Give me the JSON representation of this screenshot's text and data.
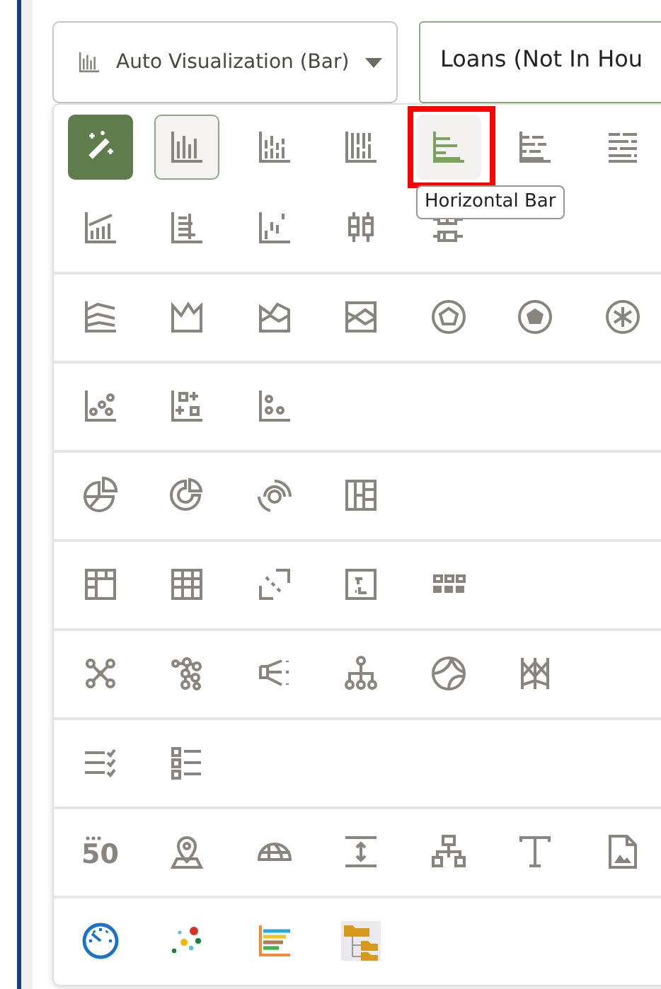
{
  "visualization_dropdown": {
    "label": "Auto Visualization (Bar)"
  },
  "data_field": {
    "value": "Loans (Not In Hou"
  },
  "groups": [
    {
      "items": [
        {
          "kind": "auto",
          "selected": false,
          "hovered": false
        },
        {
          "kind": "bar",
          "selected": true,
          "hovered": false
        },
        {
          "kind": "stacked-bar",
          "selected": false,
          "hovered": false
        },
        {
          "kind": "stacked-bar-full",
          "selected": false,
          "hovered": false
        },
        {
          "kind": "horizontal-bar",
          "selected": false,
          "hovered": true,
          "tooltip": "Horizontal Bar"
        },
        {
          "kind": "horizontal-stacked",
          "selected": false,
          "hovered": false
        },
        {
          "kind": "horizontal-stacked-full",
          "selected": false,
          "hovered": false
        },
        {
          "kind": "combo",
          "selected": false,
          "hovered": false
        },
        {
          "kind": "horizontal-combo",
          "selected": false,
          "hovered": false
        },
        {
          "kind": "waterfall",
          "selected": false,
          "hovered": false
        },
        {
          "kind": "boxplot",
          "selected": false,
          "hovered": false
        },
        {
          "kind": "horizontal-boxplot",
          "selected": false,
          "hovered": false
        }
      ]
    },
    {
      "items": [
        {
          "kind": "line",
          "selected": false,
          "hovered": false
        },
        {
          "kind": "area",
          "selected": false,
          "hovered": false
        },
        {
          "kind": "stacked-area",
          "selected": false,
          "hovered": false
        },
        {
          "kind": "area-full",
          "selected": false,
          "hovered": false
        },
        {
          "kind": "radar-line",
          "selected": false,
          "hovered": false
        },
        {
          "kind": "radar-filled",
          "selected": false,
          "hovered": false
        },
        {
          "kind": "radar-bar",
          "selected": false,
          "hovered": false
        }
      ]
    },
    {
      "items": [
        {
          "kind": "scatter",
          "selected": false,
          "hovered": false
        },
        {
          "kind": "scatter-symbols",
          "selected": false,
          "hovered": false
        },
        {
          "kind": "dot-plot",
          "selected": false,
          "hovered": false
        }
      ]
    },
    {
      "items": [
        {
          "kind": "pie",
          "selected": false,
          "hovered": false
        },
        {
          "kind": "donut",
          "selected": false,
          "hovered": false
        },
        {
          "kind": "sunburst",
          "selected": false,
          "hovered": false
        },
        {
          "kind": "treemap",
          "selected": false,
          "hovered": false
        }
      ]
    },
    {
      "items": [
        {
          "kind": "pivot",
          "selected": false,
          "hovered": false
        },
        {
          "kind": "table",
          "selected": false,
          "hovered": false
        },
        {
          "kind": "matrix",
          "selected": false,
          "hovered": false
        },
        {
          "kind": "heatmap",
          "selected": false,
          "hovered": false
        },
        {
          "kind": "tile-grid",
          "selected": false,
          "hovered": false
        }
      ]
    },
    {
      "items": [
        {
          "kind": "network",
          "selected": false,
          "hovered": false
        },
        {
          "kind": "graph",
          "selected": false,
          "hovered": false
        },
        {
          "kind": "funnel",
          "selected": false,
          "hovered": false
        },
        {
          "kind": "hierarchy",
          "selected": false,
          "hovered": false
        },
        {
          "kind": "chord",
          "selected": false,
          "hovered": false
        },
        {
          "kind": "parallel",
          "selected": false,
          "hovered": false
        }
      ]
    },
    {
      "items": [
        {
          "kind": "checklist",
          "selected": false,
          "hovered": false
        },
        {
          "kind": "list",
          "selected": false,
          "hovered": false
        }
      ]
    },
    {
      "items": [
        {
          "kind": "tile",
          "text": "50",
          "selected": false,
          "hovered": false
        },
        {
          "kind": "map-pin",
          "selected": false,
          "hovered": false
        },
        {
          "kind": "map-dome",
          "selected": false,
          "hovered": false
        },
        {
          "kind": "spacer",
          "selected": false,
          "hovered": false
        },
        {
          "kind": "blocks",
          "selected": false,
          "hovered": false
        },
        {
          "kind": "text",
          "selected": false,
          "hovered": false
        },
        {
          "kind": "image",
          "selected": false,
          "hovered": false
        }
      ]
    },
    {
      "items": [
        {
          "kind": "gauge",
          "selected": false,
          "hovered": false
        },
        {
          "kind": "color-scatter",
          "selected": false,
          "hovered": false
        },
        {
          "kind": "color-bars",
          "selected": false,
          "hovered": false
        },
        {
          "kind": "folder-tree",
          "selected": false,
          "hovered": false
        }
      ]
    }
  ]
}
